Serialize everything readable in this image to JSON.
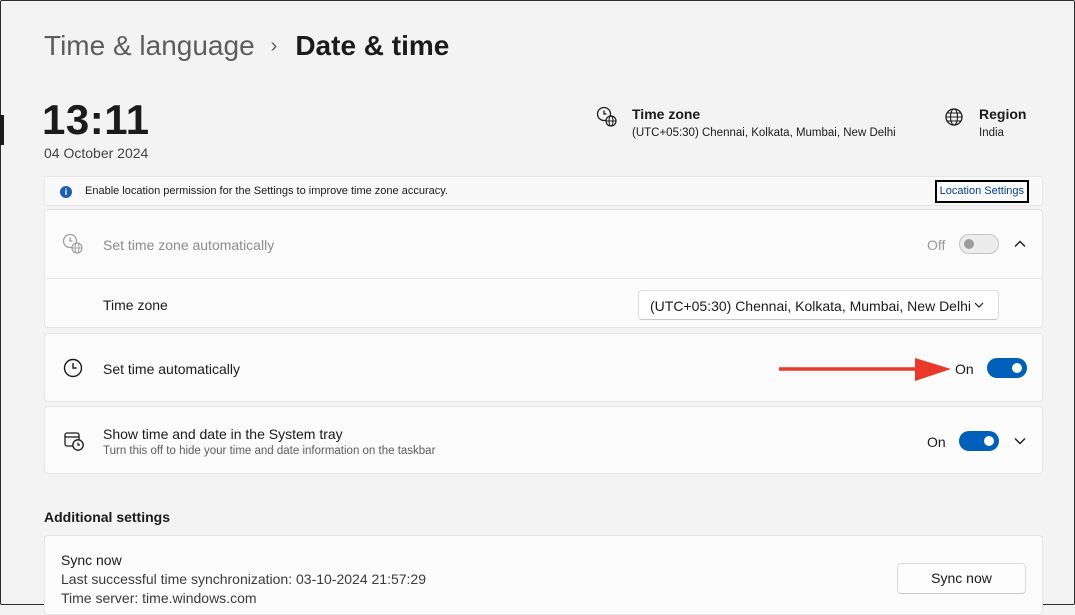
{
  "breadcrumb": {
    "parent": "Time & language",
    "separator": "›",
    "current": "Date & time"
  },
  "clock": {
    "time": "13:11",
    "date": "04 October 2024"
  },
  "time_zone_info": {
    "title": "Time zone",
    "value": "(UTC+05:30) Chennai, Kolkata, Mumbai, New Delhi",
    "icon": "clock-globe-icon"
  },
  "region_info": {
    "title": "Region",
    "value": "India",
    "icon": "globe-icon"
  },
  "banner": {
    "icon": "info-icon",
    "text": "Enable location permission for the Settings to improve time zone accuracy.",
    "link": "Location Settings"
  },
  "auto_timezone": {
    "label": "Set time zone automatically",
    "state": "Off",
    "enabled": false,
    "icon": "clock-globe-icon",
    "expanded": true
  },
  "timezone_row": {
    "label": "Time zone",
    "selected": "(UTC+05:30) Chennai, Kolkata, Mumbai, New Delhi"
  },
  "auto_time": {
    "label": "Set time automatically",
    "state": "On",
    "enabled": true,
    "icon": "clock-icon"
  },
  "systray": {
    "label": "Show time and date in the System tray",
    "description": "Turn this off to hide your time and date information on the taskbar",
    "state": "On",
    "enabled": true,
    "icon": "calendar-clock-icon"
  },
  "additional": {
    "title": "Additional settings",
    "sync": {
      "title": "Sync now",
      "last_sync": "Last successful time synchronization: 03-10-2024 21:57:29",
      "server": "Time server: time.windows.com",
      "button": "Sync now"
    }
  },
  "colors": {
    "accent": "#005fb8",
    "annotation_arrow": "#e8392b"
  }
}
